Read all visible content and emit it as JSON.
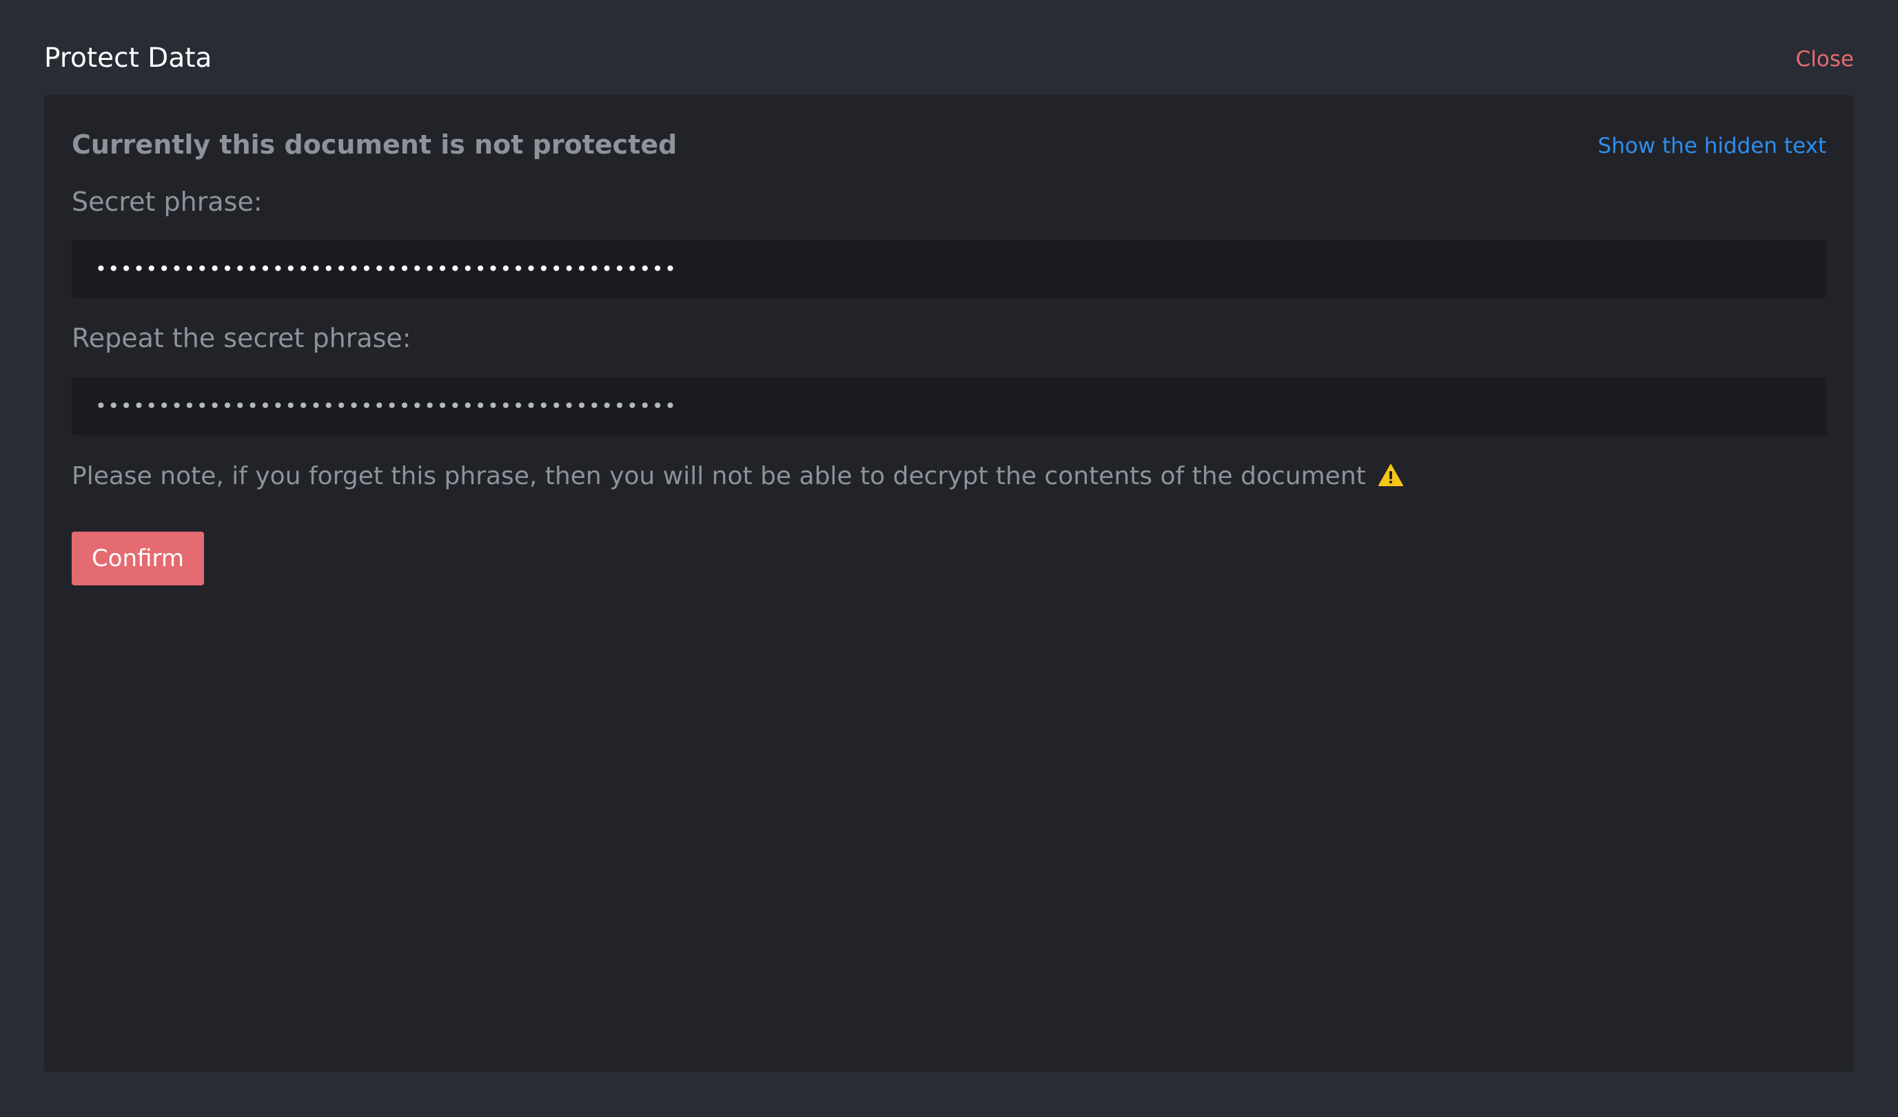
{
  "dialog": {
    "title": "Protect Data",
    "close_label": "Close"
  },
  "panel": {
    "status_heading": "Currently this document is not protected",
    "show_hidden_label": "Show the hidden text",
    "secret_label": "Secret phrase:",
    "secret_value": "••••••••••••••••••••••••••••••••••••••••••••••",
    "repeat_label": "Repeat the secret phrase:",
    "repeat_value": "••••••••••••••••••••••••••••••••••••••••••••••",
    "note": "Please note, if you forget this phrase, then you will not be able to decrypt the contents of the document",
    "warning_icon": "warning-icon",
    "confirm_label": "Confirm"
  },
  "colors": {
    "background": "#292c35",
    "panel": "#212328",
    "input": "#1a1b1f",
    "accent_red": "#e46b71",
    "link_blue": "#2d8ef0",
    "muted_text": "#8e929b",
    "warning": "#f5c518"
  }
}
